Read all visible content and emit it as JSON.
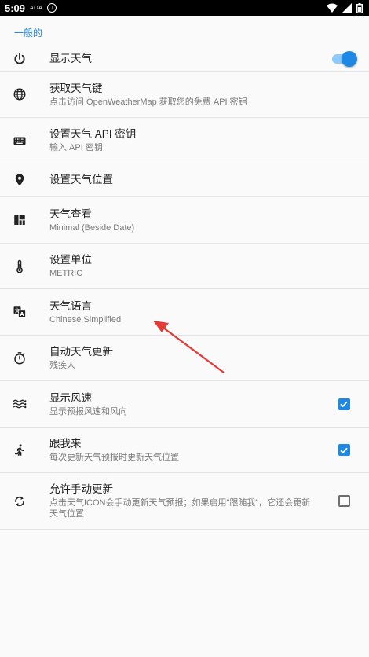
{
  "status_bar": {
    "time": "5:09",
    "indicator_text": "AOA"
  },
  "section": {
    "title": "一般的"
  },
  "prefs": [
    {
      "title": "显示天气",
      "summary": "",
      "widget": "switch",
      "checked": true,
      "icon": "power-icon"
    },
    {
      "title": "获取天气键",
      "summary": "点击访问 OpenWeatherMap 获取您的免费 API 密钥",
      "icon": "globe-icon"
    },
    {
      "title": "设置天气 API 密钥",
      "summary": "输入 API 密钥",
      "icon": "keyboard-icon"
    },
    {
      "title": "设置天气位置",
      "summary": "",
      "icon": "location-pin-icon"
    },
    {
      "title": "天气查看",
      "summary": "Minimal (Beside Date)",
      "icon": "layout-icon"
    },
    {
      "title": "设置单位",
      "summary": "METRIC",
      "icon": "thermometer-icon"
    },
    {
      "title": "天气语言",
      "summary": "Chinese Simplified",
      "icon": "translate-icon"
    },
    {
      "title": "自动天气更新",
      "summary": "残疾人",
      "icon": "timer-icon"
    },
    {
      "title": "显示风速",
      "summary": "显示预报风速和风向",
      "widget": "checkbox",
      "checked": true,
      "icon": "wind-icon"
    },
    {
      "title": "跟我来",
      "summary": "每次更新天气预报时更新天气位置",
      "widget": "checkbox",
      "checked": true,
      "icon": "walking-icon"
    },
    {
      "title": "允许手动更新",
      "summary": "点击天气ICON会手动更新天气预报；如果启用\"跟随我\"，它还会更新天气位置",
      "widget": "checkbox",
      "checked": false,
      "icon": "sync-icon"
    }
  ],
  "colors": {
    "accent": "#1e88e5",
    "annotation_arrow": "#e53935"
  }
}
